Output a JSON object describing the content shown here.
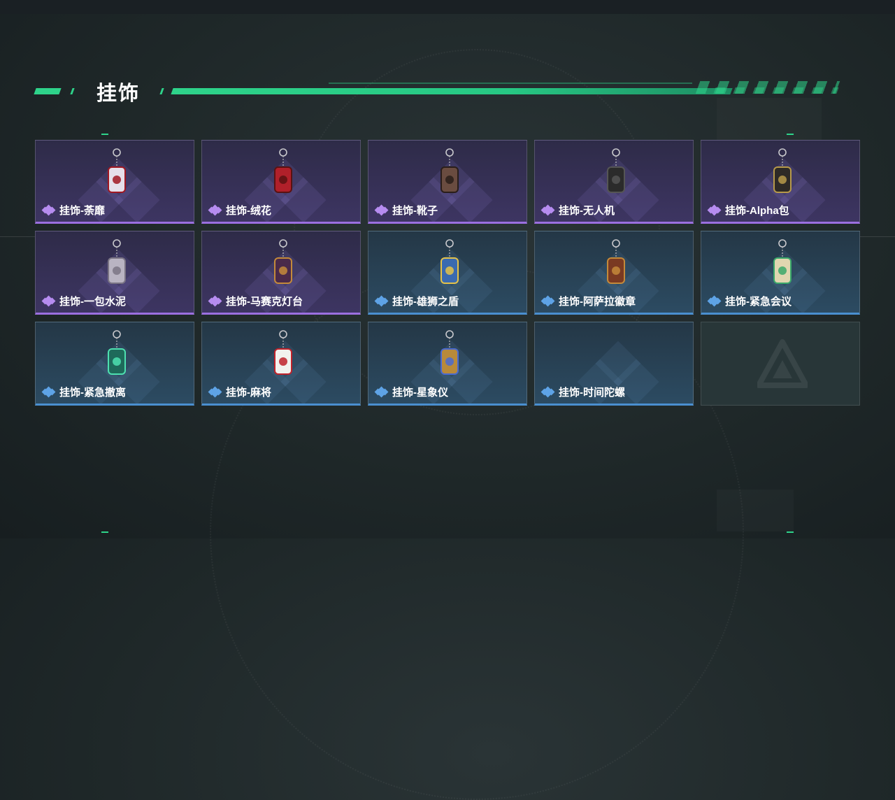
{
  "header": {
    "title": "挂饰"
  },
  "items": [
    {
      "name": "挂饰-荼靡",
      "rarity": "purple",
      "charm_icon": "flower-skull-charm-icon",
      "charm_color": "#e6e0ea",
      "accent": "#a01822"
    },
    {
      "name": "挂饰-绒花",
      "rarity": "purple",
      "charm_icon": "red-rose-charm-icon",
      "charm_color": "#b0202a",
      "accent": "#5a1212"
    },
    {
      "name": "挂饰-靴子",
      "rarity": "purple",
      "charm_icon": "boot-charm-icon",
      "charm_color": "#6a4c40",
      "accent": "#2a1e1a"
    },
    {
      "name": "挂饰-无人机",
      "rarity": "purple",
      "charm_icon": "drone-charm-icon",
      "charm_color": "#2b2b2b",
      "accent": "#555555"
    },
    {
      "name": "挂饰-Alpha包",
      "rarity": "purple",
      "charm_icon": "alpha-bag-charm-icon",
      "charm_color": "#2e2a26",
      "accent": "#b79a4a"
    },
    {
      "name": "挂饰-一包水泥",
      "rarity": "purple",
      "charm_icon": "cement-bag-charm-icon",
      "charm_color": "#b9b4c2",
      "accent": "#7a7484"
    },
    {
      "name": "挂饰-马赛克灯台",
      "rarity": "purple",
      "charm_icon": "mosaic-lamp-charm-icon",
      "charm_color": "#4a2a4a",
      "accent": "#c48a3a"
    },
    {
      "name": "挂饰-雄狮之盾",
      "rarity": "blue",
      "charm_icon": "lion-shield-charm-icon",
      "charm_color": "#3a6ab0",
      "accent": "#e4c24a"
    },
    {
      "name": "挂饰-阿萨拉徽章",
      "rarity": "blue",
      "charm_icon": "asala-badge-charm-icon",
      "charm_color": "#7a3a22",
      "accent": "#c48a3a"
    },
    {
      "name": "挂饰-紧急会议",
      "rarity": "blue",
      "charm_icon": "emergency-meeting-charm-icon",
      "charm_color": "#e0d6b0",
      "accent": "#3aa86a"
    },
    {
      "name": "挂饰-紧急撤离",
      "rarity": "blue",
      "charm_icon": "emergency-evac-charm-icon",
      "charm_color": "#1e6a5a",
      "accent": "#4ee0b0"
    },
    {
      "name": "挂饰-麻将",
      "rarity": "blue",
      "charm_icon": "mahjong-tile-charm-icon",
      "charm_color": "#f2f2ee",
      "accent": "#c0222a"
    },
    {
      "name": "挂饰-星象仪",
      "rarity": "blue",
      "charm_icon": "astrolabe-charm-icon",
      "charm_color": "#b88a3a",
      "accent": "#4a6ad0"
    },
    {
      "name": "挂饰-时间陀螺",
      "rarity": "blue",
      "charm_icon": "",
      "charm_color": "",
      "accent": ""
    }
  ],
  "empty_slot": {
    "icon": "delta-force-logo-icon"
  }
}
